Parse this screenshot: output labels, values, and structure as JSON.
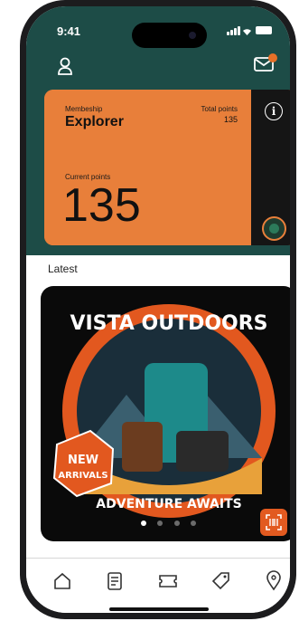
{
  "status_bar": {
    "time": "9:41"
  },
  "header": {
    "profile_icon": "user-icon",
    "mail_icon": "mail-icon"
  },
  "membership_card": {
    "membership_label": "Membeship",
    "membership_value": "Explorer",
    "total_points_label": "Total points",
    "total_points_value": "135",
    "current_points_label": "Current points",
    "current_points_value": "135",
    "accent": "#e87f3a"
  },
  "section": {
    "title": "Latest"
  },
  "banner": {
    "title_top": "VISTA OUTDOORS",
    "title_bottom": "ADVENTURE AWAITS",
    "badge_line1": "NEW",
    "badge_line2": "ARRIVALS",
    "carousel_count": 4,
    "carousel_active": 0
  },
  "nav": {
    "items": [
      "home-icon",
      "receipt-icon",
      "ticket-icon",
      "tag-icon",
      "location-icon"
    ]
  },
  "colors": {
    "header_bg": "#1d4c47",
    "card_bg": "#e87f3a",
    "accent": "#e25a20"
  }
}
